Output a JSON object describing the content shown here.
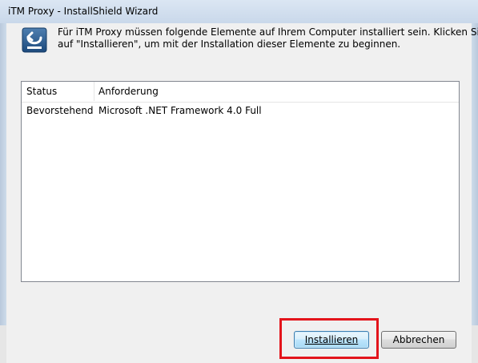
{
  "window": {
    "title": "iTM Proxy - InstallShield Wizard"
  },
  "dialog": {
    "icon": "installer-icon",
    "message_line1": "Für iTM Proxy müssen folgende Elemente auf Ihrem Computer installiert sein. Klicken Sie",
    "message_line2": "auf \"Installieren\", um mit der Installation dieser Elemente zu beginnen."
  },
  "list": {
    "columns": [
      "Status",
      "Anforderung"
    ],
    "rows": [
      {
        "status": "Bevorstehend",
        "requirement": "Microsoft .NET Framework 4.0 Full"
      }
    ]
  },
  "buttons": {
    "install_label": "Installieren",
    "cancel_label": "Abbrechen"
  },
  "colors": {
    "highlight": "#e3141b",
    "title_bar": "#c9d8ea"
  }
}
